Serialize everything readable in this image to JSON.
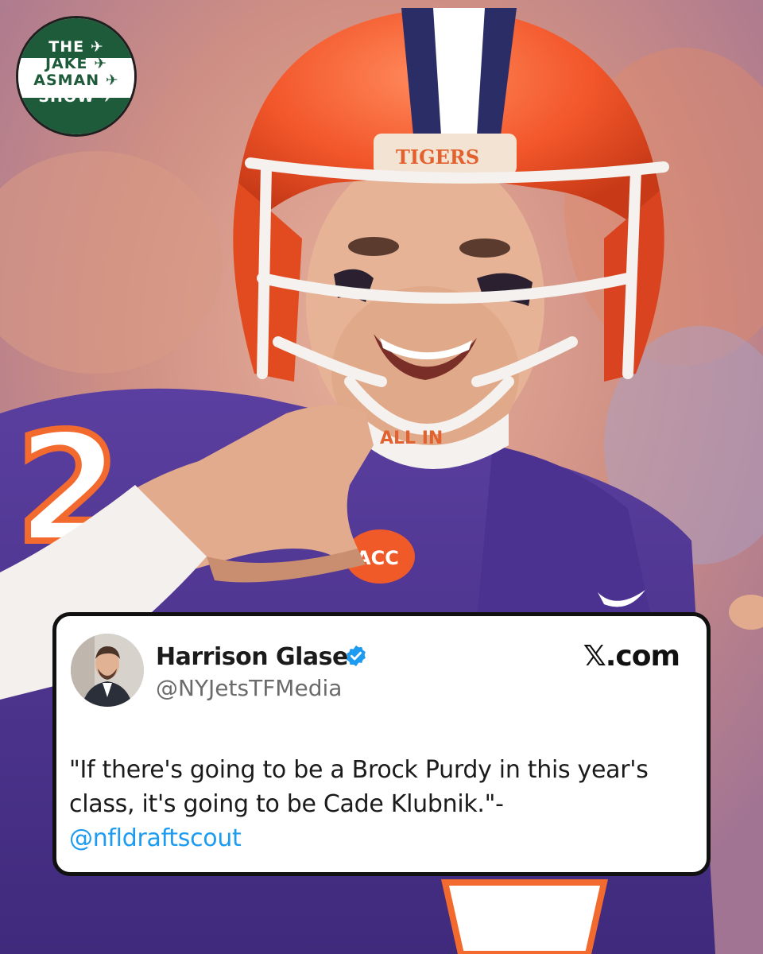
{
  "image": {
    "description_icon": "football-player-photo",
    "helmet_text": "TIGERS",
    "chinstrap_text": "ALL IN",
    "jersey_number": "2",
    "patch_text": "ACC"
  },
  "logo": {
    "lines": [
      "THE",
      "JAKE",
      "ASMAN",
      "SHOW"
    ],
    "icon": "airplane-icon",
    "green": "#1e5b3a",
    "white": "#ffffff"
  },
  "tweet": {
    "author_name": "Harrison Glaser",
    "author_handle": "@NYJetsTFMedia",
    "verified_icon": "verified-badge-icon",
    "source_label": "𝕏.com",
    "quote_text": "\"If there's going to be a Brock Purdy in this year's class, it's going to be Cade Klubnik.\"-",
    "mention": "@nfldraftscout",
    "accent": "#1d9bf0"
  }
}
